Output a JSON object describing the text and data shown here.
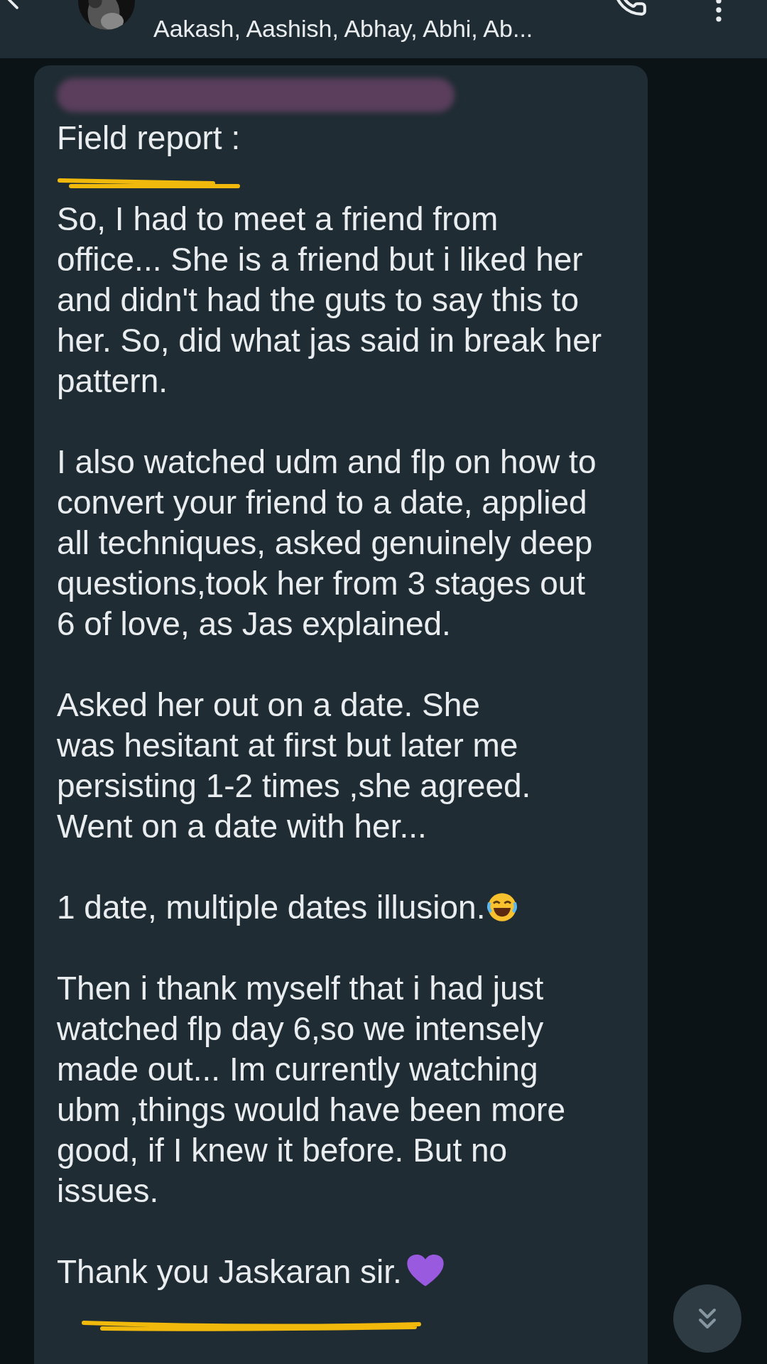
{
  "header": {
    "subtitle": "Aakash, Aashish, Abhay, Abhi, Ab..."
  },
  "message": {
    "paragraphs": [
      {
        "kind": "text",
        "lines": [
          "Field report :"
        ]
      },
      {
        "kind": "text",
        "lines": [
          "So, I had to meet a friend from",
          "office... She is a friend but i liked her",
          "and didn't had the guts to say this to",
          "her. So, did what jas said in break her",
          "pattern."
        ]
      },
      {
        "kind": "text",
        "lines": [
          "I also watched udm and flp on how to",
          "convert your friend to a date, applied",
          "all techniques, asked genuinely deep",
          "questions,took her from 3 stages out",
          "6 of love, as Jas explained."
        ]
      },
      {
        "kind": "text",
        "lines": [
          "Asked her out on a date. She",
          "was hesitant at first but later me",
          "persisting 1-2 times ,she agreed.",
          "Went on a date with her..."
        ]
      },
      {
        "kind": "laughing",
        "lines": [
          "1 date, multiple dates illusion."
        ]
      },
      {
        "kind": "text",
        "lines": [
          "Then i thank myself that i had just",
          "watched flp day 6,so we intensely",
          "made out... Im currently watching",
          "ubm ,things would have been more",
          "good, if I knew it before. But no",
          "issues."
        ]
      },
      {
        "kind": "heart",
        "lines": [
          "Thank you Jaskaran sir."
        ]
      }
    ]
  }
}
